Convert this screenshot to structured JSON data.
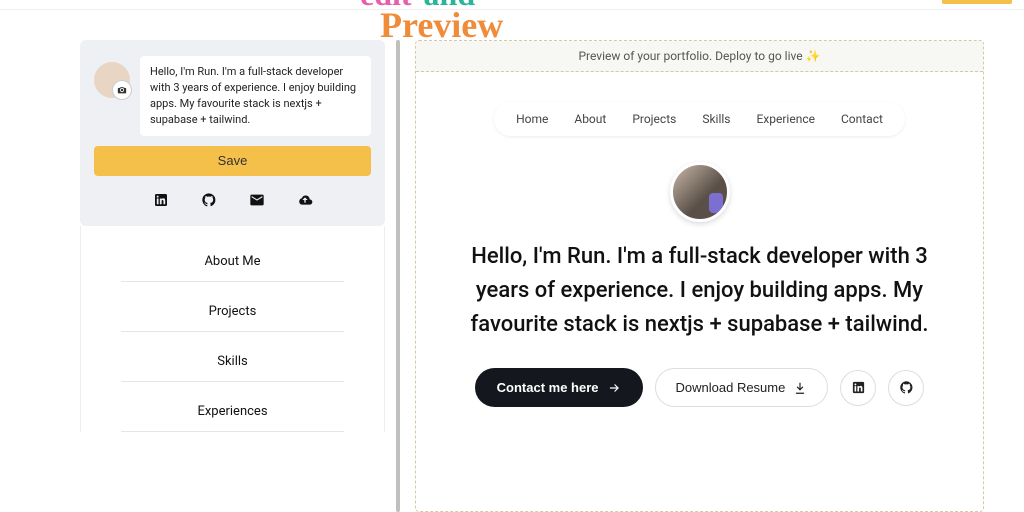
{
  "overlay": {
    "word1": "edit",
    "word2": "and",
    "word3": "Preview"
  },
  "editor": {
    "bio": "Hello, I'm Run. I'm a full-stack developer with 3 years of experience. I enjoy building apps. My favourite stack is nextjs + supabase + tailwind.",
    "save_label": "Save",
    "sections": [
      "About Me",
      "Projects",
      "Skills",
      "Experiences"
    ]
  },
  "preview": {
    "banner": "Preview of your portfolio. Deploy to go live ✨",
    "nav": [
      "Home",
      "About",
      "Projects",
      "Skills",
      "Experience",
      "Contact"
    ],
    "hero_text": "Hello, I'm Run. I'm a full-stack developer with 3 years of experience. I enjoy building apps. My favourite stack is nextjs + supabase + tailwind.",
    "cta_contact": "Contact me here",
    "cta_resume": "Download Resume"
  }
}
